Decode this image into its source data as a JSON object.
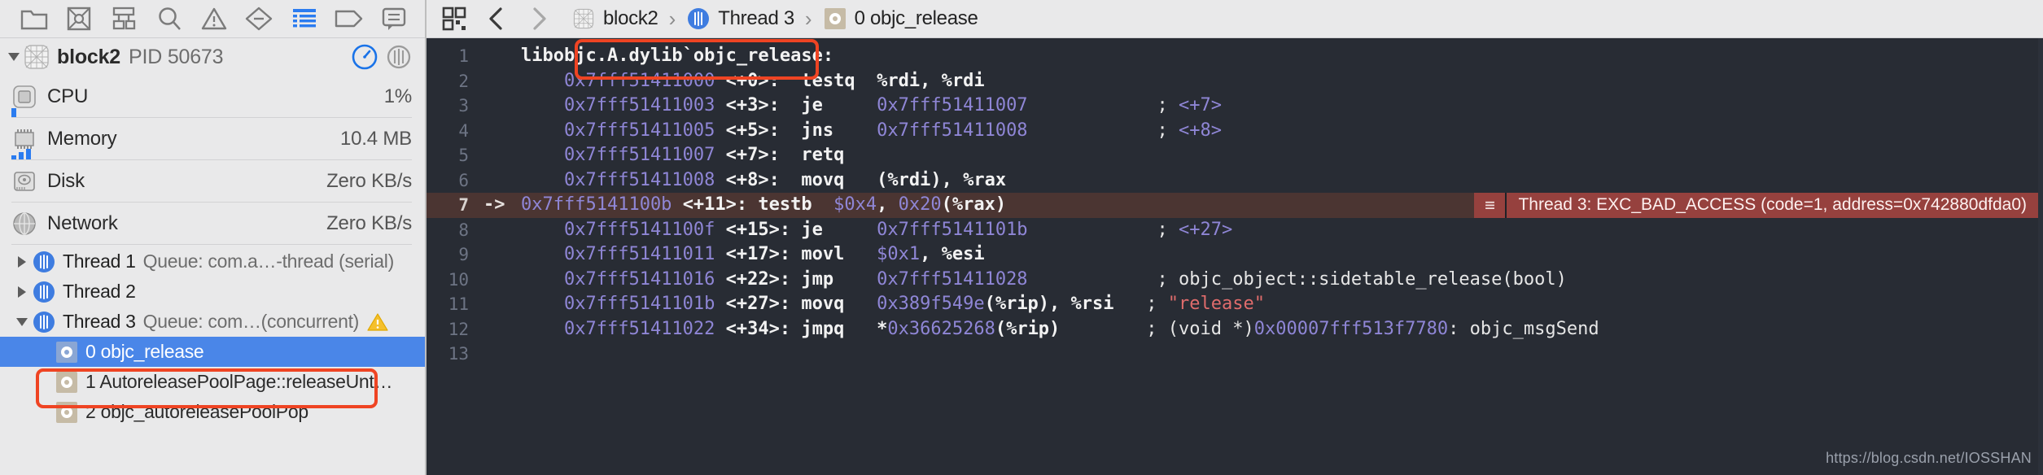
{
  "navigator": {
    "toolbar_icons": [
      {
        "name": "folder-icon",
        "label": "Project navigator"
      },
      {
        "name": "crossed-box-icon",
        "label": "Source control navigator"
      },
      {
        "name": "hierarchy-icon",
        "label": "Symbol navigator"
      },
      {
        "name": "search-icon",
        "label": "Find navigator"
      },
      {
        "name": "warning-triangle-icon",
        "label": "Issue navigator"
      },
      {
        "name": "diamond-minus-icon",
        "label": "Test navigator"
      },
      {
        "name": "debug-list-icon",
        "label": "Debug navigator"
      },
      {
        "name": "tag-icon",
        "label": "Breakpoint navigator"
      },
      {
        "name": "report-bubble-icon",
        "label": "Report navigator"
      }
    ],
    "process": {
      "title": "block2",
      "pid": "PID 50673",
      "gauge_button": "gauge-dial-icon",
      "thread_button": "thread-cylinder-icon"
    },
    "gauges": [
      {
        "icon": "cpu-chip-icon",
        "label": "CPU",
        "value": "1%",
        "bars": [
          3
        ]
      },
      {
        "icon": "memory-chip-icon",
        "label": "Memory",
        "value": "10.4 MB",
        "bars": [
          4,
          8,
          12
        ]
      },
      {
        "icon": "disk-drive-icon",
        "label": "Disk",
        "value": "Zero KB/s",
        "bars": []
      },
      {
        "icon": "network-globe-icon",
        "label": "Network",
        "value": "Zero KB/s",
        "bars": []
      }
    ],
    "threads": [
      {
        "expanded": false,
        "name": "Thread 1",
        "queue": "Queue: com.a…-thread (serial)",
        "warning": false
      },
      {
        "expanded": false,
        "name": "Thread 2",
        "queue": "",
        "warning": false
      },
      {
        "expanded": true,
        "name": "Thread 3",
        "queue": "Queue: com…(concurrent)",
        "warning": true
      }
    ],
    "frames": [
      {
        "text": "0 objc_release",
        "selected": true,
        "icon": "gear-frame-icon"
      },
      {
        "text": "1 AutoreleasePoolPage::releaseUnt…",
        "selected": false,
        "icon": "gear-frame-icon"
      },
      {
        "text": "2 objc_autoreleasePoolPop",
        "selected": false,
        "icon": "gear-frame-icon"
      }
    ]
  },
  "jump_bar": {
    "related_items_icon": "related-items-icon",
    "back_icon": "chevron-left-icon",
    "forward_icon": "chevron-right-icon",
    "breadcrumbs": [
      {
        "icon": "project-icon",
        "label": "block2"
      },
      {
        "icon": "thread-cylinder-icon",
        "label": "Thread 3"
      },
      {
        "icon": "gear-frame-icon",
        "label": "0 objc_release"
      }
    ],
    "separator": "›"
  },
  "colors": {
    "accent_blue": "#4a86e8",
    "highlight_red": "#ef4423",
    "exception_bg": "#96413e",
    "error_line_bg": "#4b3532",
    "editor_bg": "#282c34",
    "addr_purple": "#8f86d6",
    "string_red": "#e06c6c"
  },
  "editor": {
    "lines": [
      {
        "num": "1",
        "arrow": "",
        "error": false,
        "spans": [
          {
            "t": "libobjc.A.dylib`objc_release:",
            "c": "c-bold"
          }
        ]
      },
      {
        "num": "2",
        "arrow": "",
        "error": false,
        "spans": [
          {
            "t": "    ",
            "c": "c-white"
          },
          {
            "t": "0x7fff51411000",
            "c": "c-addr"
          },
          {
            "t": " ",
            "c": "c-white"
          },
          {
            "t": "<+0>",
            "c": "c-bold"
          },
          {
            "t": ":  ",
            "c": "c-bold"
          },
          {
            "t": "testq  %rdi, %rdi",
            "c": "c-bold"
          }
        ]
      },
      {
        "num": "3",
        "arrow": "",
        "error": false,
        "spans": [
          {
            "t": "    ",
            "c": "c-white"
          },
          {
            "t": "0x7fff51411003",
            "c": "c-addr"
          },
          {
            "t": " ",
            "c": "c-white"
          },
          {
            "t": "<+3>",
            "c": "c-bold"
          },
          {
            "t": ":  ",
            "c": "c-bold"
          },
          {
            "t": "je     ",
            "c": "c-bold"
          },
          {
            "t": "0x7fff51411007",
            "c": "c-addr"
          },
          {
            "t": "            ; ",
            "c": "c-cmt"
          },
          {
            "t": "<+7>",
            "c": "c-addr"
          }
        ]
      },
      {
        "num": "4",
        "arrow": "",
        "error": false,
        "spans": [
          {
            "t": "    ",
            "c": "c-white"
          },
          {
            "t": "0x7fff51411005",
            "c": "c-addr"
          },
          {
            "t": " ",
            "c": "c-white"
          },
          {
            "t": "<+5>",
            "c": "c-bold"
          },
          {
            "t": ":  ",
            "c": "c-bold"
          },
          {
            "t": "jns    ",
            "c": "c-bold"
          },
          {
            "t": "0x7fff51411008",
            "c": "c-addr"
          },
          {
            "t": "            ; ",
            "c": "c-cmt"
          },
          {
            "t": "<+8>",
            "c": "c-addr"
          }
        ]
      },
      {
        "num": "5",
        "arrow": "",
        "error": false,
        "spans": [
          {
            "t": "    ",
            "c": "c-white"
          },
          {
            "t": "0x7fff51411007",
            "c": "c-addr"
          },
          {
            "t": " ",
            "c": "c-white"
          },
          {
            "t": "<+7>",
            "c": "c-bold"
          },
          {
            "t": ":  ",
            "c": "c-bold"
          },
          {
            "t": "retq",
            "c": "c-bold"
          }
        ]
      },
      {
        "num": "6",
        "arrow": "",
        "error": false,
        "spans": [
          {
            "t": "    ",
            "c": "c-white"
          },
          {
            "t": "0x7fff51411008",
            "c": "c-addr"
          },
          {
            "t": " ",
            "c": "c-white"
          },
          {
            "t": "<+8>",
            "c": "c-bold"
          },
          {
            "t": ":  ",
            "c": "c-bold"
          },
          {
            "t": "movq   (%rdi), %rax",
            "c": "c-bold"
          }
        ]
      },
      {
        "num": "7",
        "arrow": "->",
        "error": true,
        "spans": [
          {
            "t": "0x7fff5141100b",
            "c": "c-addr"
          },
          {
            "t": " ",
            "c": "c-white"
          },
          {
            "t": "<+11>",
            "c": "c-bold"
          },
          {
            "t": ": ",
            "c": "c-bold"
          },
          {
            "t": "testb  ",
            "c": "c-bold"
          },
          {
            "t": "$0x4",
            "c": "c-addr"
          },
          {
            "t": ", ",
            "c": "c-bold"
          },
          {
            "t": "0x20",
            "c": "c-addr"
          },
          {
            "t": "(%rax)",
            "c": "c-bold"
          }
        ]
      },
      {
        "num": "8",
        "arrow": "",
        "error": false,
        "spans": [
          {
            "t": "    ",
            "c": "c-white"
          },
          {
            "t": "0x7fff5141100f",
            "c": "c-addr"
          },
          {
            "t": " ",
            "c": "c-white"
          },
          {
            "t": "<+15>",
            "c": "c-bold"
          },
          {
            "t": ": ",
            "c": "c-bold"
          },
          {
            "t": "je     ",
            "c": "c-bold"
          },
          {
            "t": "0x7fff5141101b",
            "c": "c-addr"
          },
          {
            "t": "            ; ",
            "c": "c-cmt"
          },
          {
            "t": "<+27>",
            "c": "c-addr"
          }
        ]
      },
      {
        "num": "9",
        "arrow": "",
        "error": false,
        "spans": [
          {
            "t": "    ",
            "c": "c-white"
          },
          {
            "t": "0x7fff51411011",
            "c": "c-addr"
          },
          {
            "t": " ",
            "c": "c-white"
          },
          {
            "t": "<+17>",
            "c": "c-bold"
          },
          {
            "t": ": ",
            "c": "c-bold"
          },
          {
            "t": "movl   ",
            "c": "c-bold"
          },
          {
            "t": "$0x1",
            "c": "c-addr"
          },
          {
            "t": ", %esi",
            "c": "c-bold"
          }
        ]
      },
      {
        "num": "10",
        "arrow": "",
        "error": false,
        "spans": [
          {
            "t": "    ",
            "c": "c-white"
          },
          {
            "t": "0x7fff51411016",
            "c": "c-addr"
          },
          {
            "t": " ",
            "c": "c-white"
          },
          {
            "t": "<+22>",
            "c": "c-bold"
          },
          {
            "t": ": ",
            "c": "c-bold"
          },
          {
            "t": "jmp    ",
            "c": "c-bold"
          },
          {
            "t": "0x7fff51411028",
            "c": "c-addr"
          },
          {
            "t": "            ; ",
            "c": "c-cmt"
          },
          {
            "t": "objc_object::sidetable_release(bool)",
            "c": "c-cmt"
          }
        ]
      },
      {
        "num": "11",
        "arrow": "",
        "error": false,
        "spans": [
          {
            "t": "    ",
            "c": "c-white"
          },
          {
            "t": "0x7fff5141101b",
            "c": "c-addr"
          },
          {
            "t": " ",
            "c": "c-white"
          },
          {
            "t": "<+27>",
            "c": "c-bold"
          },
          {
            "t": ": ",
            "c": "c-bold"
          },
          {
            "t": "movq   ",
            "c": "c-bold"
          },
          {
            "t": "0x389f549e",
            "c": "c-addr"
          },
          {
            "t": "(%rip), %rsi",
            "c": "c-bold"
          },
          {
            "t": "   ; ",
            "c": "c-cmt"
          },
          {
            "t": "\"release\"",
            "c": "c-str"
          }
        ]
      },
      {
        "num": "12",
        "arrow": "",
        "error": false,
        "spans": [
          {
            "t": "    ",
            "c": "c-white"
          },
          {
            "t": "0x7fff51411022",
            "c": "c-addr"
          },
          {
            "t": " ",
            "c": "c-white"
          },
          {
            "t": "<+34>",
            "c": "c-bold"
          },
          {
            "t": ": ",
            "c": "c-bold"
          },
          {
            "t": "jmpq   ",
            "c": "c-bold"
          },
          {
            "t": "*",
            "c": "c-bold"
          },
          {
            "t": "0x36625268",
            "c": "c-addr"
          },
          {
            "t": "(%rip)",
            "c": "c-bold"
          },
          {
            "t": "        ; (void *)",
            "c": "c-cmt"
          },
          {
            "t": "0x00007fff513f7780",
            "c": "c-addr"
          },
          {
            "t": ": objc_msgSend",
            "c": "c-cmt"
          }
        ]
      },
      {
        "num": "13",
        "arrow": "",
        "error": false,
        "spans": []
      }
    ],
    "exception": {
      "grip": "≡",
      "message": "Thread 3: EXC_BAD_ACCESS (code=1, address=0x742880dfda0)",
      "line_index": 6
    },
    "watermark": "https://blog.csdn.net/IOSSHAN"
  }
}
